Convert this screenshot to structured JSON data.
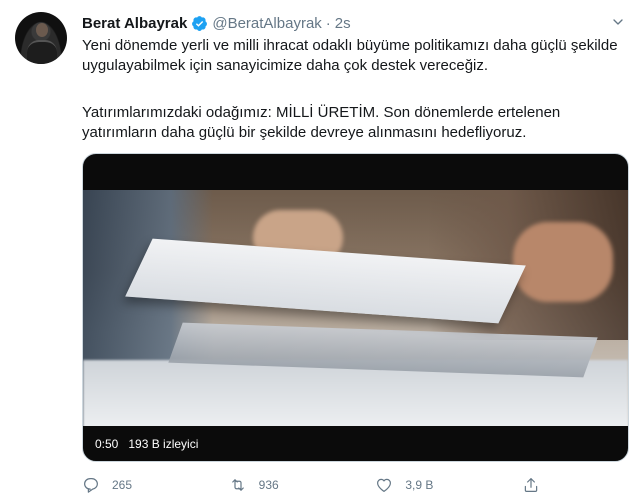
{
  "tweet": {
    "author_name": "Berat Albayrak",
    "handle": "@BeratAlbayrak",
    "separator": "·",
    "time": "2s",
    "paragraph1": "Yeni dönemde yerli ve milli ihracat odaklı büyüme politikamızı daha güçlü şekilde uygulayabilmek için sanayicimize daha çok destek vereceğiz.",
    "paragraph2": "Yatırımlarımızdaki odağımız: MİLLİ ÜRETİM. Son dönemlerde ertelenen yatırımların daha güçlü bir şekilde devreye alınmasını hedefliyoruz."
  },
  "video": {
    "duration": "0:50",
    "views": "193 B izleyici"
  },
  "actions": {
    "replies": "265",
    "retweets": "936",
    "likes": "3,9 B"
  },
  "colors": {
    "verified": "#1da1f2",
    "secondary_text": "#657786",
    "primary_text": "#14171a"
  },
  "icons": [
    "verified-icon",
    "chevron-down-icon",
    "reply-icon",
    "retweet-icon",
    "like-icon",
    "share-icon"
  ]
}
